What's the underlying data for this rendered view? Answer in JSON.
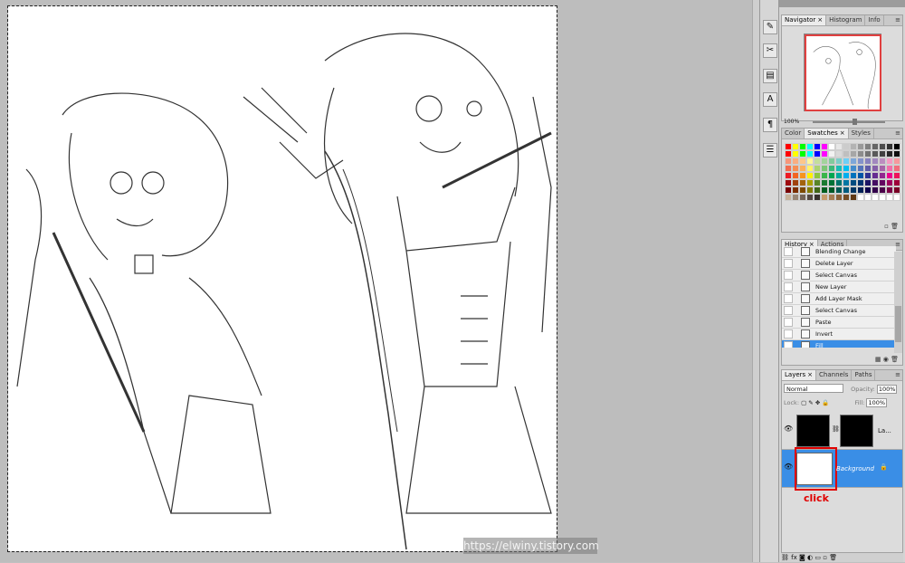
{
  "panels": {
    "navigator": {
      "tabs": [
        "Navigator",
        "Histogram",
        "Info"
      ],
      "zoom": "100%"
    },
    "swatches": {
      "tabs": [
        "Color",
        "Swatches",
        "Styles"
      ],
      "rows": [
        [
          "#ff0000",
          "#ffff00",
          "#00ff00",
          "#00ffff",
          "#0000ff",
          "#ff00ff",
          "#ffffff",
          "#e6e6e6",
          "#cccccc",
          "#b3b3b3",
          "#999999",
          "#808080",
          "#666666",
          "#4d4d4d",
          "#333333",
          "#000000"
        ],
        [
          "#ff0000",
          "#ffff00",
          "#00ff00",
          "#00ffff",
          "#0000ff",
          "#ff00ff",
          "#f2f2f2",
          "#d9d9d9",
          "#bfbfbf",
          "#a6a6a6",
          "#8c8c8c",
          "#737373",
          "#595959",
          "#404040",
          "#262626",
          "#0d0d0d"
        ],
        [
          "#f7977a",
          "#f9ad81",
          "#fdc68a",
          "#fff79a",
          "#c4df9b",
          "#a2d39c",
          "#82ca9d",
          "#7bcdc8",
          "#6ecff6",
          "#7ea7d8",
          "#8493ca",
          "#8882be",
          "#a187be",
          "#bc8dbf",
          "#f49ac2",
          "#f6989d"
        ],
        [
          "#f26c4f",
          "#f68e55",
          "#fbaf5c",
          "#fff467",
          "#acd372",
          "#7cc576",
          "#3bb878",
          "#1abbb4",
          "#00bff3",
          "#438ccb",
          "#5574b9",
          "#605ca8",
          "#855fa8",
          "#a763a8",
          "#f06ea9",
          "#f26d7d"
        ],
        [
          "#ed1c24",
          "#f26522",
          "#f7941d",
          "#fff200",
          "#8dc63f",
          "#39b54a",
          "#00a651",
          "#00a99d",
          "#00aeef",
          "#0072bc",
          "#0054a6",
          "#2e3192",
          "#662d91",
          "#92278f",
          "#ec008c",
          "#ed145b"
        ],
        [
          "#9e0b0f",
          "#a0410d",
          "#a3620a",
          "#aba000",
          "#598527",
          "#1a7b30",
          "#007236",
          "#00746b",
          "#0076a3",
          "#004b80",
          "#003471",
          "#1b1464",
          "#440e62",
          "#630460",
          "#9e005d",
          "#9e0039"
        ],
        [
          "#790000",
          "#7b2e00",
          "#7d4900",
          "#827b00",
          "#406618",
          "#005e20",
          "#005826",
          "#005952",
          "#005b7f",
          "#003663",
          "#002157",
          "#0d004c",
          "#32004b",
          "#4b0049",
          "#7b0046",
          "#7a0026"
        ],
        [
          "#c7b299",
          "#998675",
          "#736357",
          "#534741",
          "#37302d",
          "#c69c6d",
          "#a67c52",
          "#8c6239",
          "#754c24",
          "#603913",
          "#ffffff",
          "#ffffff",
          "#ffffff",
          "#ffffff",
          "#ffffff",
          "#ffffff"
        ]
      ]
    },
    "history": {
      "tabs": [
        "History",
        "Actions"
      ],
      "items": [
        "Blending Change",
        "Delete Layer",
        "Select Canvas",
        "New Layer",
        "Add Layer Mask",
        "Select Canvas",
        "Paste",
        "Invert",
        "Fill"
      ],
      "selected_index": 8
    },
    "layers": {
      "tabs": [
        "Layers",
        "Channels",
        "Paths"
      ],
      "blend_mode": "Normal",
      "opacity_label": "Opacity:",
      "opacity": "100%",
      "lock_label": "Lock:",
      "fill_label": "Fill:",
      "fill": "100%",
      "layer1_name": "La...",
      "background_name": "Background"
    }
  },
  "annotation": {
    "click_label": "click"
  },
  "watermark": "https://elwiny.tistory.com"
}
